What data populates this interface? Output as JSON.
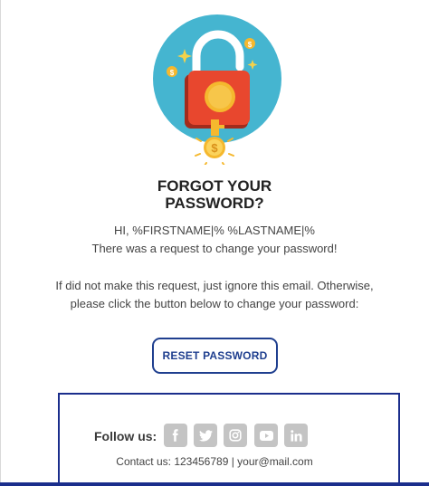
{
  "email": {
    "title_line1": "FORGOT YOUR",
    "title_line2": "PASSWORD?",
    "greeting": "HI, %FIRSTNAME|% %LASTNAME|%",
    "request_text": "There was a request to change your password!",
    "instruction_line1": "If did not make this request, just ignore this email. Otherwise,",
    "instruction_line2": "please click the button below to change your password:",
    "button_label": "RESET PASSWORD"
  },
  "footer": {
    "follow_label": "Follow us:",
    "social_icons": [
      "facebook-icon",
      "twitter-icon",
      "instagram-icon",
      "youtube-icon",
      "linkedin-icon"
    ],
    "contact_text": "Contact us: 123456789 | your@mail.com"
  },
  "colors": {
    "accent": "#1f3f8f",
    "footer_border": "#1b2e8c",
    "hero_circle": "#45b5d0",
    "lock_body": "#e8472e",
    "key_gold": "#f5b82e",
    "social_bg": "#c4c4c4"
  }
}
